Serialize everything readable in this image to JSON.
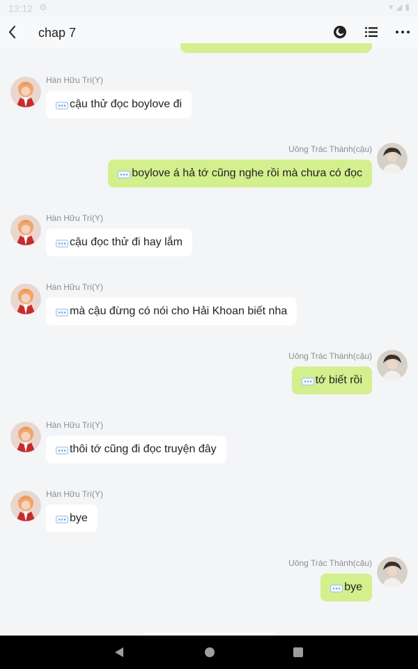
{
  "status_bar": {
    "time": "13:12"
  },
  "header": {
    "title": "chap 7"
  },
  "colors": {
    "sent_bubble": "#d4ef8e",
    "received_bubble": "#ffffff",
    "background": "#f4f5f7"
  },
  "messages": [
    {
      "side": "left",
      "sender": "Hàn Hữu Trí(Y)",
      "text": "cậu thử đọc boylove đi"
    },
    {
      "side": "right",
      "sender": "Uông Trác Thành(cậu)",
      "text": "boylove á hả tớ cũng nghe rồi mà chưa có đọc"
    },
    {
      "side": "left",
      "sender": "Hàn Hữu Trí(Y)",
      "text": "cậu đọc thử đi hay lắm"
    },
    {
      "side": "left",
      "sender": "Hàn Hữu Trí(Y)",
      "text": "mà cậu đừng có nói cho Hải Khoan biết nha"
    },
    {
      "side": "right",
      "sender": "Uông Trác Thành(cậu)",
      "text": "tớ biết rồi"
    },
    {
      "side": "left",
      "sender": "Hàn Hữu Trí(Y)",
      "text": "thôi tớ cũng đi đọc truyện đây"
    },
    {
      "side": "left",
      "sender": "Hàn Hữu Trí(Y)",
      "text": "bye"
    },
    {
      "side": "right",
      "sender": "Uông Trác Thành(cậu)",
      "text": "bye"
    }
  ]
}
